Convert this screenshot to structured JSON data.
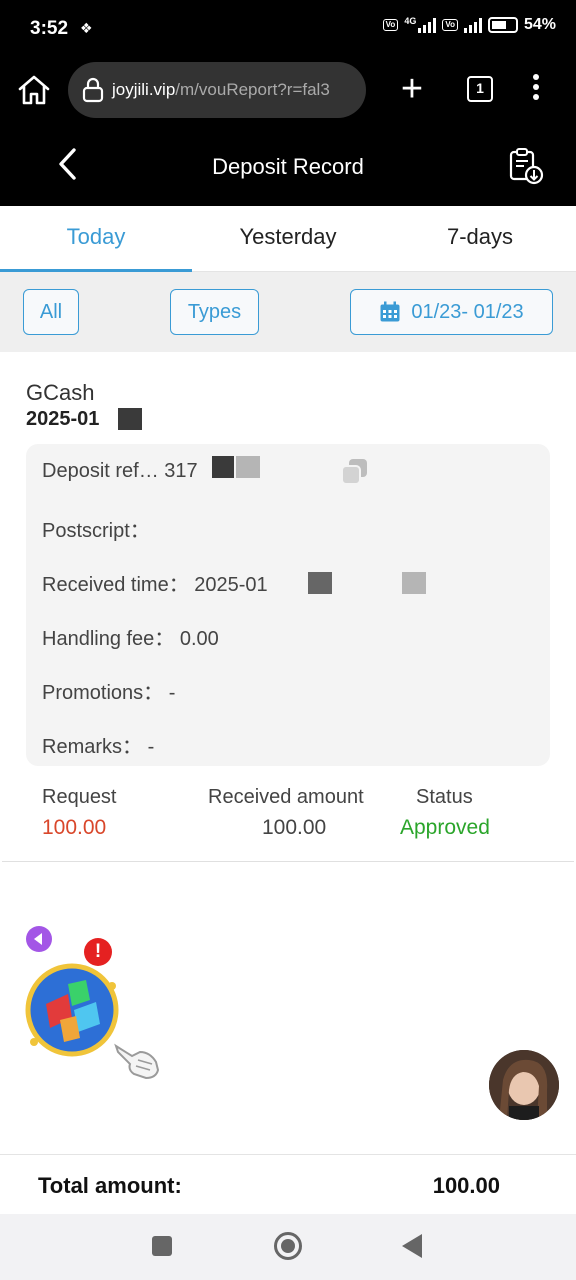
{
  "status_bar": {
    "time": "3:52",
    "network_label": "4G",
    "battery": "54%"
  },
  "browser": {
    "url_domain": "joyjili.vip",
    "url_path": "/m/vouReport?r=fal3",
    "tab_count": "1"
  },
  "header": {
    "title": "Deposit Record"
  },
  "tabs": [
    {
      "label": "Today",
      "active": true
    },
    {
      "label": "Yesterday",
      "active": false
    },
    {
      "label": "7-days",
      "active": false
    }
  ],
  "filters": {
    "all_label": "All",
    "types_label": "Types",
    "date_range": "01/23- 01/23"
  },
  "record": {
    "method": "GCash",
    "date_prefix": "2025-01",
    "deposit_ref": "Deposit ref…  317",
    "postscript": "Postscript：",
    "received_time": "Received time： 2025-01",
    "handling_fee": "Handling fee： 0.00",
    "promotions": "Promotions： -",
    "remarks": "Remarks： -",
    "request_label": "Request",
    "request_value": "100.00",
    "received_label": "Received amount",
    "received_value": "100.00",
    "status_label": "Status",
    "status_value": "Approved"
  },
  "floating": {
    "alert": "!"
  },
  "total": {
    "label": "Total amount:",
    "value": "100.00"
  },
  "colors": {
    "accent": "#3a9bd5",
    "request_red": "#d9472b",
    "approved_green": "#2ba52b"
  }
}
